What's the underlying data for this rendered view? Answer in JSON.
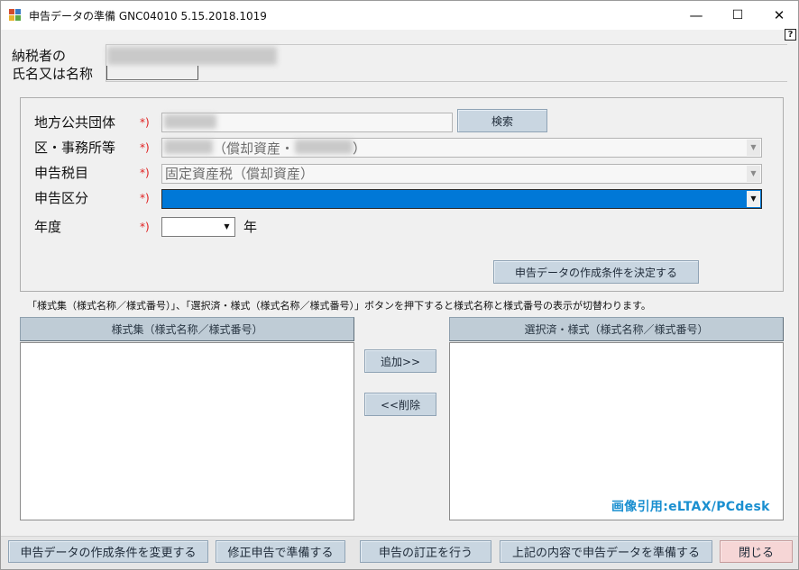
{
  "window": {
    "title": "申告データの準備 GNC04010  5.15.2018.1019",
    "controls": {
      "minimize": "—",
      "maximize": "☐",
      "close": "✕"
    },
    "help_label": "?"
  },
  "taxpayer": {
    "label_line1": "納税者の",
    "label_line2": "氏名又は名称"
  },
  "form": {
    "required_mark": "*)",
    "local_gov": {
      "label": "地方公共団体",
      "search_button": "検索"
    },
    "office": {
      "label": "区・事務所等",
      "value": "（償却資産・",
      "value_end": "）"
    },
    "tax_item": {
      "label": "申告税目",
      "value": "固定資産税（償却資産）"
    },
    "declaration_type": {
      "label": "申告区分",
      "value": ""
    },
    "fiscal_year": {
      "label": "年度",
      "value": "",
      "suffix": "年"
    },
    "decide_button": "申告データの作成条件を決定する"
  },
  "hint_text": "「様式集（様式名称／様式番号）」、「選択済・様式（様式名称／様式番号）」ボタンを押下すると様式名称と様式番号の表示が切替わります。",
  "left_list": {
    "header": "様式集（様式名称／様式番号）",
    "items": []
  },
  "right_list": {
    "header": "選択済・様式（様式名称／様式番号）",
    "items": []
  },
  "middle_buttons": {
    "add": "追加>>",
    "remove": "<<削除"
  },
  "watermark": "画像引用:eLTAX/PCdesk",
  "bottom_buttons": {
    "change_conditions": "申告データの作成条件を変更する",
    "amended_return": "修正申告で準備する",
    "correction": "申告の訂正を行う",
    "prepare": "上記の内容で申告データを準備する",
    "close": "閉じる"
  },
  "colors": {
    "selection_blue": "#0078d7",
    "required_red": "#e02020",
    "button_blue": "#c9d6e1",
    "close_button_pink": "#f6d6d6",
    "watermark_blue": "#1a8fd0"
  },
  "icons": {
    "dropdown": "▼"
  }
}
